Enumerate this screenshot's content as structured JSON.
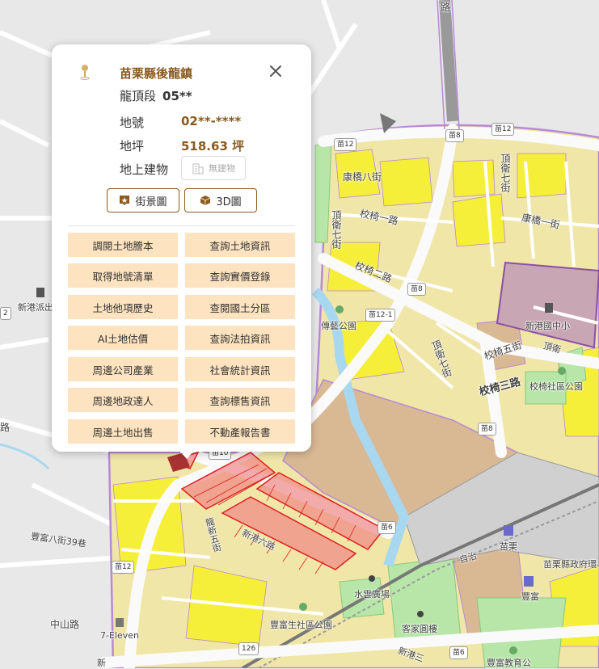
{
  "popup": {
    "title": "苗栗縣後龍鎮",
    "section_label": "龍頂段",
    "section_value": "05**",
    "lot_label": "地號",
    "lot_value": "02**-****",
    "area_label": "地坪",
    "area_value": "518.63 坪",
    "building_label": "地上建物",
    "building_value": "無建物",
    "street_view": "街景圖",
    "view_3d": "3D圖",
    "actions": [
      "調閱土地謄本",
      "查詢土地資訊",
      "取得地號清單",
      "查詢實價登錄",
      "土地他項歷史",
      "查閱國土分區",
      "AI土地估價",
      "查詢法拍資訊",
      "周邊公司產業",
      "社會統計資訊",
      "周邊地政達人",
      "查詢標售資訊",
      "周邊土地出售",
      "不動產報告書"
    ],
    "accent": "#8a5a1e",
    "button_bg": "#fde3bf"
  },
  "map": {
    "labels": {
      "kangqiao8": "康橋八街",
      "jiaoyi1": "校椅一路",
      "jiaoyi2": "校椅二路",
      "jiaoyi5": "校椅五街",
      "jiaoyi3": "校椅三路",
      "kangqiao1": "康橋一街",
      "dingwei7": "頂衛七街",
      "dingwei7b": "頂衛七街",
      "dingwei_left": "頂衛七街",
      "xingang_school": "新港國中小",
      "chuanyi_park": "傳藝公園",
      "jiaoyi_park": "校椅社區公園",
      "xingang_police": "新港派出",
      "fengfu8": "豐富八街39巷",
      "zhongshan": "中山路",
      "seven": "7-Eleven",
      "longxin": "龍新五街",
      "xingang6": "新港六路",
      "fengfu_park": "豐富生社區公園",
      "shuiyun": "水雲廣場",
      "hakka": "客家圓樓",
      "miaoli_station": "苗栗",
      "fengfu_station": "豐富",
      "county_gov": "苗栗縣政府環",
      "zhiping": "自治",
      "xingang3": "新港三",
      "fengfu_edu": "豐富教育公",
      "road": "路",
      "road2": "路",
      "dingwei_short": "頂衛",
      "xin": "新"
    },
    "shields": {
      "m8a": "苗8",
      "m12a": "苗12",
      "m12b": "苗12",
      "m8b": "苗8",
      "m121": "苗12-1",
      "m8c": "苗8",
      "m6a": "苗6",
      "m12c": "苗12",
      "m126": "126",
      "m6b": "苗6",
      "m10": "苗10",
      "two": "2"
    },
    "colors": {
      "base": "#e8e8e8",
      "zone_yellow": "#f0e6a8",
      "bright_yellow": "#f5ef3a",
      "brown": "#d9b894",
      "green": "#b8e6a8",
      "purple": "#b889d6",
      "school": "#c9a6b4",
      "parcel": "#f08080"
    }
  }
}
